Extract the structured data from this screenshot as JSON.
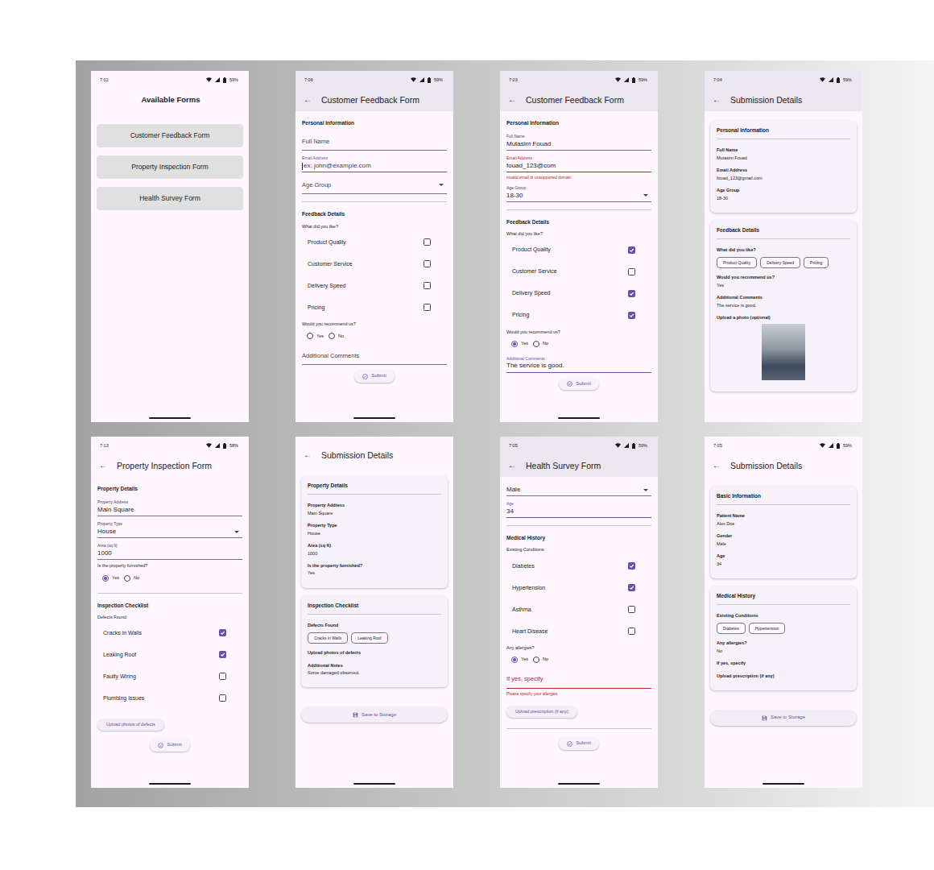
{
  "screens": [
    {
      "kind": "menu",
      "gesture_bar": true,
      "status": {
        "time": "7:02",
        "battery": "59%"
      },
      "header": {
        "title": "Available Forms",
        "scrolled": false
      },
      "items": [
        {
          "kind": "menu",
          "text": "Customer Feedback Form"
        },
        {
          "kind": "menu",
          "text": "Property Inspection Form"
        },
        {
          "kind": "menu",
          "text": "Health Survey Form"
        }
      ]
    },
    {
      "kind": "form",
      "gesture_bar": true,
      "status": {
        "time": "7:06",
        "battery": "59%"
      },
      "header": {
        "back": "←",
        "title": "Customer Feedback Form",
        "scrolled": true
      },
      "items": [
        {
          "kind": "section",
          "text": "Personal Information"
        },
        {
          "kind": "field",
          "label": "Full Name",
          "focused": false
        },
        {
          "kind": "field",
          "label": "Email Address",
          "placeholder": "ex: john@example.com",
          "focused": true
        },
        {
          "kind": "select",
          "label": "Age Group",
          "focused": false
        },
        {
          "kind": "divider"
        },
        {
          "kind": "section",
          "text": "Feedback Details"
        },
        {
          "kind": "label",
          "text": "What did you like?"
        },
        {
          "kind": "check",
          "label": "Product Quality",
          "checked": false
        },
        {
          "kind": "check",
          "label": "Customer Service",
          "checked": false
        },
        {
          "kind": "check",
          "label": "Delivery Speed",
          "checked": false
        },
        {
          "kind": "check",
          "label": "Pricing",
          "checked": false
        },
        {
          "kind": "label",
          "text": "Would you recommend us?"
        },
        {
          "kind": "radio",
          "options": [
            {
              "label": "Yes",
              "selected": false
            },
            {
              "label": "No",
              "selected": false
            }
          ]
        },
        {
          "kind": "field",
          "label": "Additional Comments",
          "focused": false
        },
        {
          "kind": "submit",
          "text": "Submit"
        }
      ]
    },
    {
      "kind": "form",
      "gesture_bar": true,
      "status": {
        "time": "7:03",
        "battery": "59%"
      },
      "header": {
        "back": "←",
        "title": "Customer Feedback Form",
        "scrolled": true
      },
      "items": [
        {
          "kind": "section",
          "text": "Personal Information"
        },
        {
          "kind": "field",
          "label": "Full Name",
          "value": "Mutasim Fouad",
          "focused": false
        },
        {
          "kind": "field",
          "label": "Email Address",
          "value": "fouad_123@com",
          "error": "Invalid email or unsupported domain",
          "focused": false
        },
        {
          "kind": "select",
          "label": "Age Group",
          "value": "18-30",
          "focused": false
        },
        {
          "kind": "divider"
        },
        {
          "kind": "section",
          "text": "Feedback Details"
        },
        {
          "kind": "label",
          "text": "What did you like?"
        },
        {
          "kind": "check",
          "label": "Product Quality",
          "checked": true
        },
        {
          "kind": "check",
          "label": "Customer Service",
          "checked": false
        },
        {
          "kind": "check",
          "label": "Delivery Speed",
          "checked": true
        },
        {
          "kind": "check",
          "label": "Pricing",
          "checked": true
        },
        {
          "kind": "label",
          "text": "Would you recommend us?"
        },
        {
          "kind": "radio",
          "options": [
            {
              "label": "Yes",
              "selected": true
            },
            {
              "label": "No",
              "selected": false
            }
          ]
        },
        {
          "kind": "field",
          "label": "Additional Comments",
          "value": "The service is good.",
          "focused": true
        },
        {
          "kind": "submit",
          "text": "Submit"
        }
      ]
    },
    {
      "kind": "details",
      "gesture_bar": false,
      "status": {
        "time": "7:04",
        "battery": "59%"
      },
      "header": {
        "back": "←",
        "title": "Submission Details",
        "scrolled": true
      },
      "items": [
        {
          "kind": "card",
          "title": "Personal Information",
          "rows": [
            {
              "kind": "detail",
              "label": "Full Name",
              "value": "Mutasim Fouad"
            },
            {
              "kind": "detail",
              "label": "Email Address",
              "value": "fouad_123@gmail.com"
            },
            {
              "kind": "detail",
              "label": "Age Group",
              "value": "18-30"
            }
          ]
        },
        {
          "kind": "card",
          "title": "Feedback Details",
          "rows": [
            {
              "kind": "chips",
              "label": "What did you like?",
              "chips": [
                "Product Quality",
                "Delivery Speed",
                "Pricing"
              ]
            },
            {
              "kind": "detail",
              "label": "Would you recommend us?",
              "value": "Yes"
            },
            {
              "kind": "detail",
              "label": "Additional Comments",
              "value": "The service is good."
            },
            {
              "kind": "photo",
              "label": "Upload a photo (optional)"
            }
          ]
        }
      ]
    },
    {
      "kind": "form",
      "gesture_bar": true,
      "status": {
        "time": "7:13",
        "battery": "58%"
      },
      "header": {
        "back": "←",
        "title": "Property Inspection Form",
        "scrolled": false
      },
      "items": [
        {
          "kind": "section",
          "text": "Property Details"
        },
        {
          "kind": "field",
          "label": "Property Address",
          "value": "Main Square",
          "focused": false
        },
        {
          "kind": "select",
          "label": "Property Type",
          "value": "House",
          "focused": false
        },
        {
          "kind": "field",
          "label": "Area (sq ft)",
          "value": "1000",
          "focused": false
        },
        {
          "kind": "label",
          "text": "Is the property furnished?"
        },
        {
          "kind": "radio",
          "options": [
            {
              "label": "Yes",
              "selected": true
            },
            {
              "label": "No",
              "selected": false
            }
          ]
        },
        {
          "kind": "divider"
        },
        {
          "kind": "section",
          "text": "Inspection Checklist"
        },
        {
          "kind": "label",
          "text": "Defects Found"
        },
        {
          "kind": "check",
          "label": "Cracks in Walls",
          "checked": true
        },
        {
          "kind": "check",
          "label": "Leaking Roof",
          "checked": true
        },
        {
          "kind": "check",
          "label": "Faulty Wiring",
          "checked": false
        },
        {
          "kind": "check",
          "label": "Plumbing Issues",
          "checked": false
        },
        {
          "kind": "tonal",
          "text": "Upload photos of defects"
        },
        {
          "kind": "submit",
          "text": "Submit"
        }
      ]
    },
    {
      "kind": "details",
      "gesture_bar": true,
      "header": {
        "back": "←",
        "title": "Submission Details",
        "scrolled": false
      },
      "items": [
        {
          "kind": "card",
          "title": "Property Details",
          "rows": [
            {
              "kind": "detail",
              "label": "Property Address",
              "value": "Main Square"
            },
            {
              "kind": "detail",
              "label": "Property Type",
              "value": "House"
            },
            {
              "kind": "detail",
              "label": "Area (sq ft)",
              "value": "1000"
            },
            {
              "kind": "detail",
              "label": "Is the property furnished?",
              "value": "Yes"
            }
          ]
        },
        {
          "kind": "card",
          "title": "Inspection Checklist",
          "rows": [
            {
              "kind": "chips",
              "label": "Defects Found",
              "chips": [
                "Cracks in Walls",
                "Leaking Roof"
              ]
            },
            {
              "kind": "detail",
              "label": "Upload photos of defects"
            },
            {
              "kind": "detail",
              "label": "Additional Notes",
              "value": "Some damaged observed."
            }
          ]
        },
        {
          "kind": "save",
          "text": "Save to Storage"
        }
      ]
    },
    {
      "kind": "form",
      "gesture_bar": true,
      "status": {
        "time": "7:05",
        "battery": "59%"
      },
      "header": {
        "back": "←",
        "title": "Health Survey Form",
        "scrolled": true
      },
      "items": [
        {
          "kind": "select",
          "value": "Male",
          "focused": false
        },
        {
          "kind": "field",
          "label": "Age",
          "value": "34",
          "focused": true
        },
        {
          "kind": "divider"
        },
        {
          "kind": "section",
          "text": "Medical History"
        },
        {
          "kind": "label",
          "text": "Existing Conditions"
        },
        {
          "kind": "check",
          "label": "Diabetes",
          "checked": true
        },
        {
          "kind": "check",
          "label": "Hypertension",
          "checked": true
        },
        {
          "kind": "check",
          "label": "Asthma",
          "checked": false
        },
        {
          "kind": "check",
          "label": "Heart Disease",
          "checked": false
        },
        {
          "kind": "label",
          "text": "Any allergies?"
        },
        {
          "kind": "radio",
          "options": [
            {
              "label": "Yes",
              "selected": true
            },
            {
              "label": "No",
              "selected": false
            }
          ]
        },
        {
          "kind": "field",
          "label": "If yes, specify",
          "error": "Please specify your allergies",
          "focused": false
        },
        {
          "kind": "tonal",
          "text": "Upload prescription (if any)"
        },
        {
          "kind": "divider"
        },
        {
          "kind": "submit",
          "text": "Submit"
        }
      ]
    },
    {
      "kind": "details",
      "gesture_bar": true,
      "status": {
        "time": "7:05",
        "battery": "59%"
      },
      "header": {
        "back": "←",
        "title": "Submission Details",
        "scrolled": false
      },
      "items": [
        {
          "kind": "card",
          "title": "Basic Information",
          "rows": [
            {
              "kind": "detail",
              "label": "Patient Name",
              "value": "Alex Doe"
            },
            {
              "kind": "detail",
              "label": "Gender",
              "value": "Male"
            },
            {
              "kind": "detail",
              "label": "Age",
              "value": "34"
            }
          ]
        },
        {
          "kind": "card",
          "title": "Medical History",
          "rows": [
            {
              "kind": "chips",
              "label": "Existing Conditions",
              "chips": [
                "Diabetes",
                "Hypertension"
              ]
            },
            {
              "kind": "detail",
              "label": "Any allergies?",
              "value": "No"
            },
            {
              "kind": "detail",
              "label": "If yes, specify"
            },
            {
              "kind": "detail",
              "label": "Upload prescription (if any)"
            }
          ]
        },
        {
          "kind": "save",
          "text": "Save to Storage"
        }
      ]
    }
  ]
}
